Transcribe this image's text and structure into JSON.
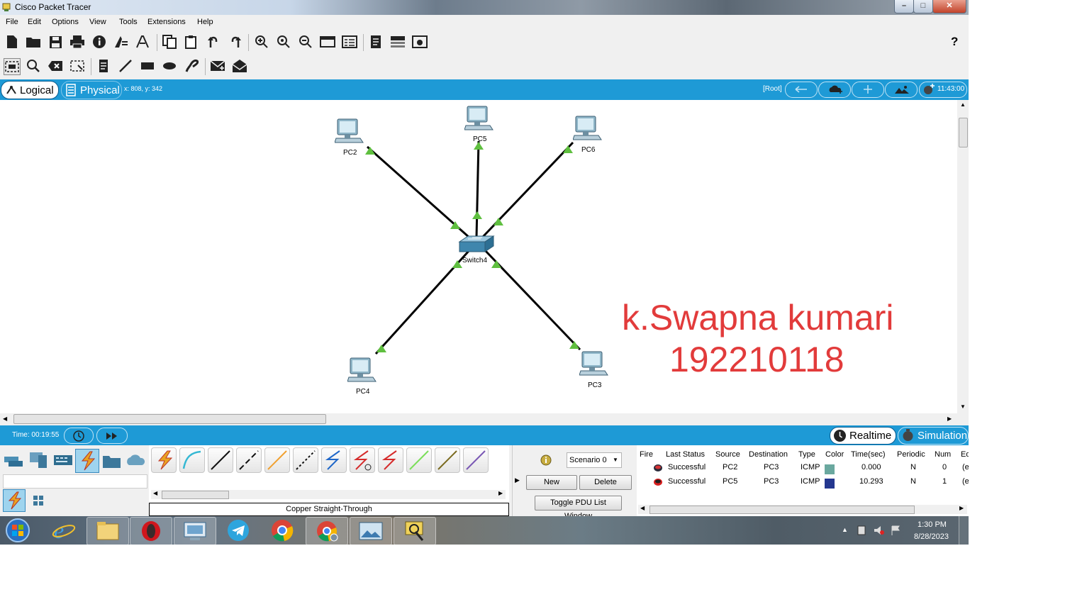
{
  "window": {
    "title": "Cisco Packet Tracer",
    "help_label": "?"
  },
  "menu": [
    "File",
    "Edit",
    "Options",
    "View",
    "Tools",
    "Extensions",
    "Help"
  ],
  "toolbar1": [
    "new-icon",
    "open-icon",
    "save-icon",
    "print-icon",
    "info-icon",
    "activity-wizard-icon",
    "text-icon",
    "copy-icon",
    "paste-icon",
    "undo-icon",
    "redo-icon",
    "zoom-in-icon",
    "zoom-reset-icon",
    "zoom-out-icon",
    "palette-icon",
    "custom-device-icon",
    "note-icon",
    "viewport-icon",
    "screenshot-icon"
  ],
  "toolbar2": [
    "select-icon",
    "inspect-icon",
    "delete-icon",
    "resize-icon",
    "note-icon",
    "line-icon",
    "rectangle-icon",
    "ellipse-icon",
    "freeform-icon",
    "simple-pdu-icon",
    "complex-pdu-icon"
  ],
  "workspace": {
    "logical_label": "Logical",
    "physical_label": "Physical",
    "coords": "x: 808, y: 342",
    "root_label": "[Root]",
    "clock": "11:43:00"
  },
  "network": {
    "devices": [
      {
        "name": "PC2",
        "type": "pc"
      },
      {
        "name": "PC5",
        "type": "pc"
      },
      {
        "name": "PC6",
        "type": "pc"
      },
      {
        "name": "Switch4",
        "type": "switch"
      },
      {
        "name": "PC4",
        "type": "pc"
      },
      {
        "name": "PC3",
        "type": "pc"
      }
    ],
    "link_status_color": "#5fbf3f"
  },
  "annotation": {
    "line1": "k.Swapna kumari",
    "line2": "192210118",
    "color": "#e23b3b"
  },
  "status": {
    "time": "Time: 00:19:55",
    "realtime_label": "Realtime",
    "simulation_label": "Simulation"
  },
  "cable_panel": {
    "selected_cable": "Copper Straight-Through"
  },
  "pdu_panel": {
    "scenario": "Scenario 0",
    "new_label": "New",
    "delete_label": "Delete",
    "toggle_label": "Toggle PDU List Window"
  },
  "pdu_table": {
    "headers": [
      "Fire",
      "Last Status",
      "Source",
      "Destination",
      "Type",
      "Color",
      "Time(sec)",
      "Periodic",
      "Num",
      "Ed"
    ],
    "rows": [
      {
        "last_status": "Successful",
        "source": "PC2",
        "destination": "PC3",
        "type": "ICMP",
        "color": "#6aa89f",
        "time": "0.000",
        "periodic": "N",
        "num": "0",
        "edit": "(e"
      },
      {
        "last_status": "Successful",
        "source": "PC5",
        "destination": "PC3",
        "type": "ICMP",
        "color": "#24378f",
        "time": "10.293",
        "periodic": "N",
        "num": "1",
        "edit": "(e"
      }
    ]
  },
  "taskbar": {
    "apps": [
      "start-orb",
      "internet-explorer",
      "file-explorer",
      "opera",
      "control-panel",
      "telegram",
      "chrome",
      "chrome-profile",
      "photos",
      "packet-tracer"
    ],
    "time": "1:30 PM",
    "date": "8/28/2023"
  }
}
